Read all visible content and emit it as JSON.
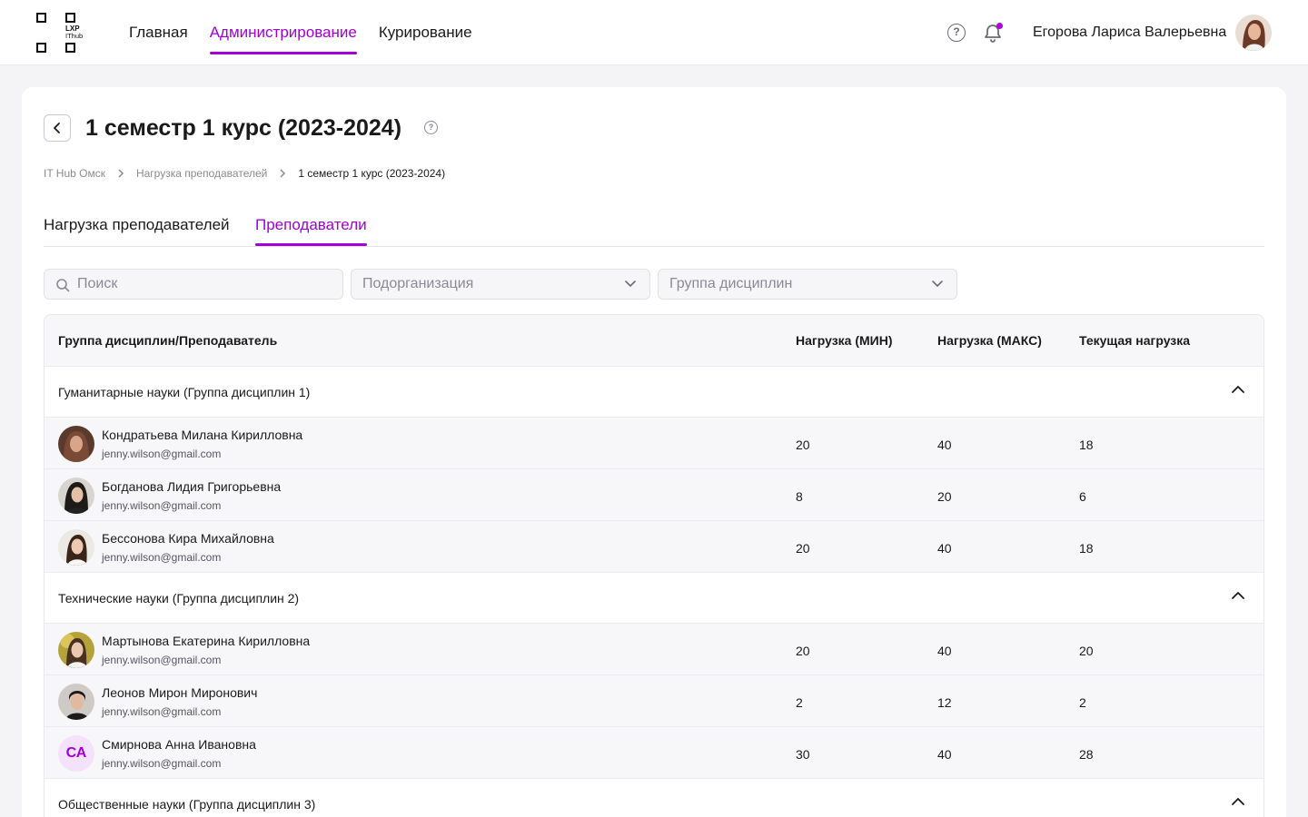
{
  "header": {
    "logo_text_1": "LXP",
    "logo_text_2": "IThub",
    "nav": [
      {
        "label": "Главная",
        "active": false
      },
      {
        "label": "Администрирование",
        "active": true
      },
      {
        "label": "Курирование",
        "active": false
      }
    ],
    "help_icon": "help-circle-icon",
    "bell_icon": "bell-icon",
    "user_name": "Егорова Лариса Валерьевна"
  },
  "page": {
    "title": "1 семестр 1 курс (2023-2024)",
    "breadcrumb": [
      "IT Hub Омск",
      "Нагрузка преподавателей",
      "1 семестр 1 курс (2023-2024)"
    ],
    "tabs": [
      {
        "label": "Нагрузка преподавателей",
        "active": false
      },
      {
        "label": "Преподаватели",
        "active": true
      }
    ]
  },
  "filters": {
    "search_placeholder": "Поиск",
    "suborg_placeholder": "Подорганизация",
    "discipline_group_placeholder": "Группа дисциплин"
  },
  "table": {
    "headers": [
      "Группа дисциплин/Преподаватель",
      "Нагрузка (МИН)",
      "Нагрузка (МАКС)",
      "Текущая нагрузка"
    ],
    "groups": [
      {
        "title": "Гуманитарные науки (Группа дисциплин 1)",
        "rows": [
          {
            "name": "Кондратьева Милана Кирилловна",
            "email": "jenny.wilson@gmail.com",
            "min": "20",
            "max": "40",
            "cur": "18"
          },
          {
            "name": "Богданова Лидия Григорьевна",
            "email": "jenny.wilson@gmail.com",
            "min": "8",
            "max": "20",
            "cur": "6"
          },
          {
            "name": "Бессонова Кира Михайловна",
            "email": "jenny.wilson@gmail.com",
            "min": "20",
            "max": "40",
            "cur": "18"
          }
        ]
      },
      {
        "title": "Технические науки (Группа дисциплин 2)",
        "rows": [
          {
            "name": "Мартынова Екатерина Кирилловна",
            "email": "jenny.wilson@gmail.com",
            "min": "20",
            "max": "40",
            "cur": "20"
          },
          {
            "name": "Леонов Мирон Миронович",
            "email": "jenny.wilson@gmail.com",
            "min": "2",
            "max": "12",
            "cur": "2"
          },
          {
            "name": "Смирнова Анна Ивановна",
            "email": "jenny.wilson@gmail.com",
            "initials": "СА",
            "min": "30",
            "max": "40",
            "cur": "28"
          }
        ]
      },
      {
        "title": "Общественные науки (Группа дисциплин 3)",
        "rows": []
      }
    ]
  },
  "colors": {
    "accent": "#a000d6",
    "initials_bg": "#f4e1fb"
  }
}
